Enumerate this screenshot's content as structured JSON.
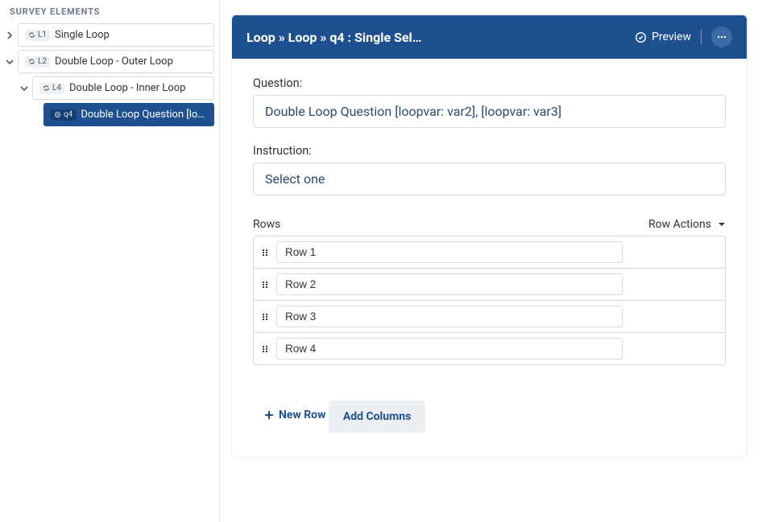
{
  "sidebar": {
    "title": "SURVEY ELEMENTS",
    "items": [
      {
        "badge_code": "L1",
        "label": "Single Loop",
        "type": "loop"
      },
      {
        "badge_code": "L2",
        "label": "Double Loop - Outer Loop",
        "type": "loop"
      },
      {
        "badge_code": "L4",
        "label": "Double Loop - Inner Loop",
        "type": "loop"
      },
      {
        "badge_code": "q4",
        "label": "Double Loop Question [loopv…",
        "type": "question",
        "selected": true
      }
    ]
  },
  "header": {
    "breadcrumb": "Loop » Loop » q4 : Single Sel…",
    "preview_label": "Preview"
  },
  "editor": {
    "question_label": "Question:",
    "question_value": "Double Loop Question [loopvar: var2],  [loopvar: var3]",
    "instruction_label": "Instruction:",
    "instruction_value": "Select one",
    "rows_label": "Rows",
    "row_actions_label": "Row Actions",
    "rows": [
      {
        "label": "Row 1"
      },
      {
        "label": "Row 2"
      },
      {
        "label": "Row 3"
      },
      {
        "label": "Row 4"
      }
    ],
    "new_row_label": "New Row",
    "add_columns_label": "Add Columns"
  }
}
